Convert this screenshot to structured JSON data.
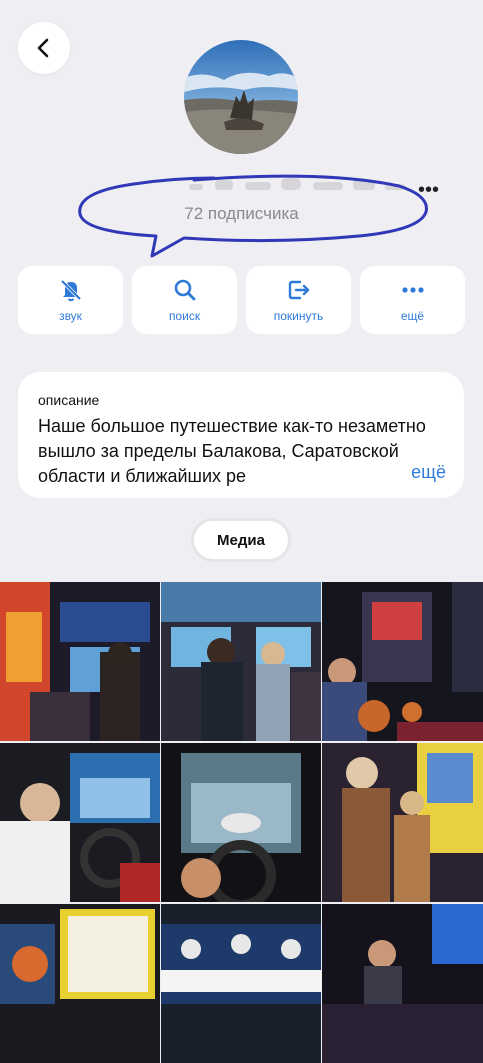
{
  "header": {
    "back_icon": "chevron-left-icon",
    "more_icon": "more-horizontal-icon",
    "subscribers": "72 подписчика"
  },
  "actions": [
    {
      "label": "звук",
      "icon": "bell-slash-icon"
    },
    {
      "label": "поиск",
      "icon": "search-icon"
    },
    {
      "label": "покинуть",
      "icon": "leave-icon"
    },
    {
      "label": "ещё",
      "icon": "more-horizontal-icon"
    }
  ],
  "description": {
    "title": "описание",
    "text": "Наше большое путешествие как-то незаметно вышло за пределы Балакова, Саратовской области и ближайших ре",
    "more": "ещё"
  },
  "media_tab": "Медиа",
  "colors": {
    "accent": "#2f7ad9",
    "background": "#eeeef3",
    "annotation": "#3038b8"
  }
}
